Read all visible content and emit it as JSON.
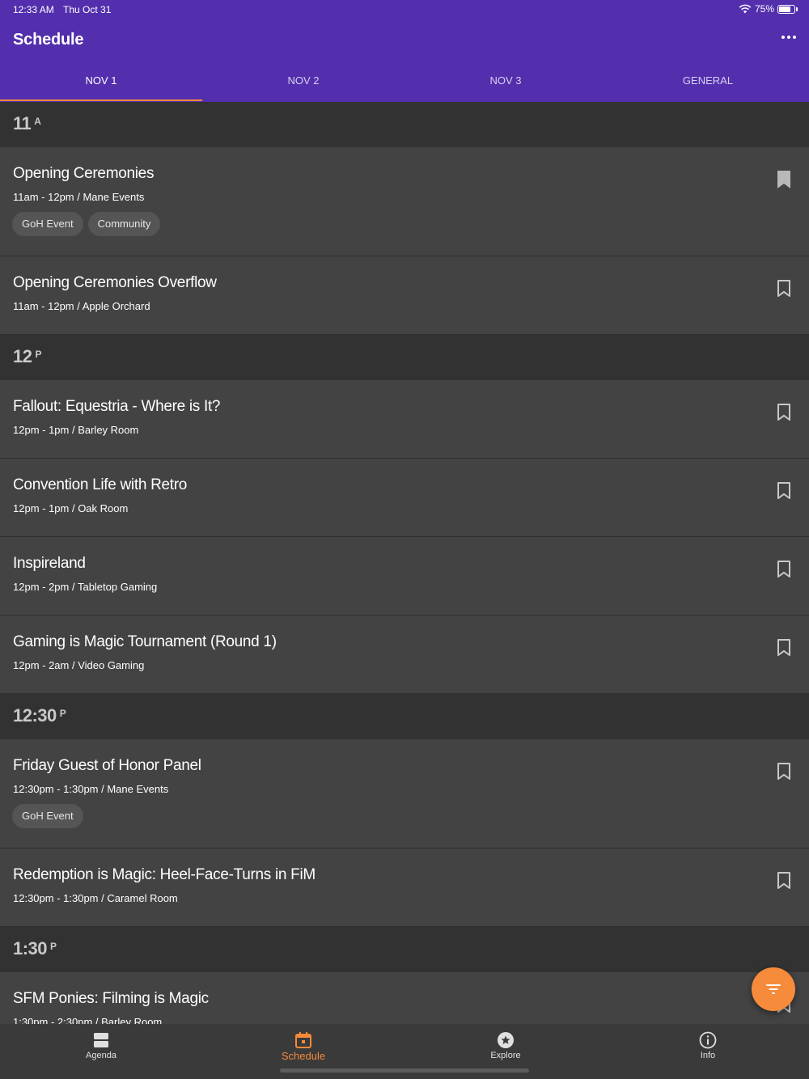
{
  "status_bar": {
    "time": "12:33 AM",
    "date": "Thu Oct 31",
    "battery": "75%"
  },
  "header": {
    "title": "Schedule",
    "more_icon": "more-horizontal-icon"
  },
  "tabs": [
    {
      "label": "NOV 1",
      "active": true
    },
    {
      "label": "NOV 2",
      "active": false
    },
    {
      "label": "NOV 3",
      "active": false
    },
    {
      "label": "GENERAL",
      "active": false
    }
  ],
  "sections": [
    {
      "time": "11",
      "suffix": "A",
      "events": [
        {
          "title": "Opening Ceremonies",
          "meta": "11am - 12pm / Mane Events",
          "tags": [
            "GoH Event",
            "Community"
          ],
          "bookmarked": true
        },
        {
          "title": "Opening Ceremonies Overflow",
          "meta": "11am - 12pm / Apple Orchard",
          "tags": [],
          "bookmarked": false
        }
      ]
    },
    {
      "time": "12",
      "suffix": "P",
      "events": [
        {
          "title": "Fallout: Equestria - Where is It?",
          "meta": "12pm - 1pm / Barley Room",
          "tags": [],
          "bookmarked": false
        },
        {
          "title": "Convention Life with Retro",
          "meta": "12pm - 1pm / Oak Room",
          "tags": [],
          "bookmarked": false
        },
        {
          "title": "Inspireland",
          "meta": "12pm - 2pm / Tabletop Gaming",
          "tags": [],
          "bookmarked": false
        },
        {
          "title": "Gaming is Magic Tournament (Round 1)",
          "meta": "12pm - 2am / Video Gaming",
          "tags": [],
          "bookmarked": false
        }
      ]
    },
    {
      "time": "12:30",
      "suffix": "P",
      "events": [
        {
          "title": "Friday Guest of Honor Panel",
          "meta": "12:30pm - 1:30pm / Mane Events",
          "tags": [
            "GoH Event"
          ],
          "bookmarked": false
        },
        {
          "title": "Redemption is Magic: Heel-Face-Turns in FiM",
          "meta": "12:30pm - 1:30pm / Caramel Room",
          "tags": [],
          "bookmarked": false
        }
      ]
    },
    {
      "time": "1:30",
      "suffix": "P",
      "events": [
        {
          "title": "SFM Ponies: Filming is Magic",
          "meta": "1:30pm - 2:30pm / Barley Room",
          "tags": [],
          "bookmarked": false
        }
      ]
    }
  ],
  "fab": {
    "icon": "filter-icon"
  },
  "bottom_nav": [
    {
      "label": "Agenda",
      "icon": "agenda-icon",
      "active": false
    },
    {
      "label": "Schedule",
      "icon": "calendar-icon",
      "active": true
    },
    {
      "label": "Explore",
      "icon": "star-circle-icon",
      "active": false
    },
    {
      "label": "Info",
      "icon": "info-icon",
      "active": false
    }
  ],
  "colors": {
    "header": "#532fae",
    "accent": "#f58a3a",
    "row": "#434343",
    "section": "#323232",
    "bottom_bar": "#3a3a3a"
  }
}
